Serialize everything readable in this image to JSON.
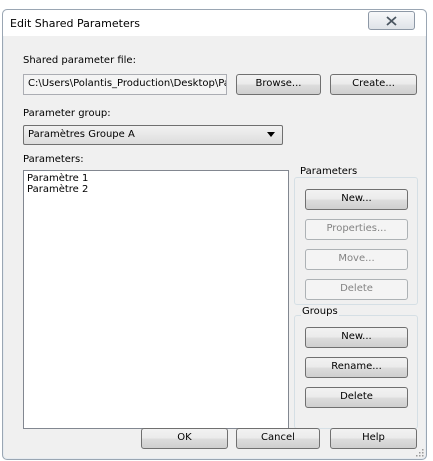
{
  "window": {
    "title": "Edit Shared Parameters"
  },
  "shared_file": {
    "label": "Shared parameter file:",
    "path": "C:\\Users\\Polantis_Production\\Desktop\\Pa",
    "browse_label": "Browse...",
    "create_label": "Create..."
  },
  "group": {
    "label": "Parameter group:",
    "selected": "Paramètres Groupe A"
  },
  "parameters": {
    "label": "Parameters:",
    "items": [
      "Paramètre 1",
      "Paramètre 2"
    ]
  },
  "param_box": {
    "title": "Parameters",
    "new_label": "New...",
    "properties_label": "Properties...",
    "move_label": "Move...",
    "delete_label": "Delete"
  },
  "groups_box": {
    "title": "Groups",
    "new_label": "New...",
    "rename_label": "Rename...",
    "delete_label": "Delete"
  },
  "footer": {
    "ok_label": "OK",
    "cancel_label": "Cancel",
    "help_label": "Help"
  },
  "icons": {
    "close": "close-x-icon",
    "dropdown": "chevron-down-icon",
    "grip": "resize-grip-icon"
  }
}
